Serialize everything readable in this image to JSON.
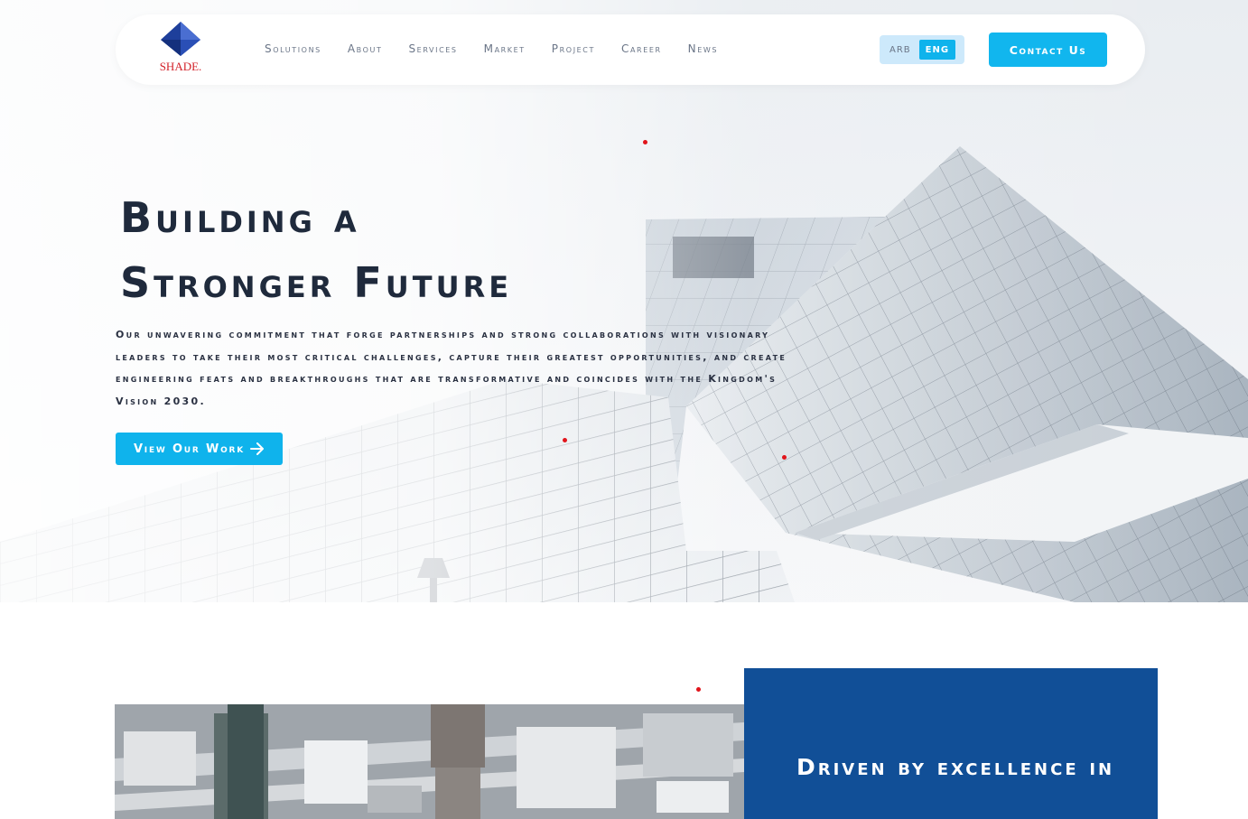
{
  "brand": {
    "logo_text": "SHADE.",
    "colors": {
      "logo_blue": "#1e3f9b",
      "logo_red": "#d3222a"
    }
  },
  "nav": {
    "links": [
      "Solutions",
      "About",
      "Services",
      "Market",
      "Project",
      "Career",
      "News"
    ]
  },
  "language": {
    "arb": "ARB",
    "eng": "ENG",
    "active": "ENG"
  },
  "contact_label": "Contact Us",
  "hero": {
    "title_line1": "Building a",
    "title_line2": "Stronger Future",
    "description": "Our unwavering commitment that forge partnerships and strong collaborations with visionary leaders to take their most critical challenges, capture their greatest opportunities, and create engineering feats and breakthroughs that are transformative and coincides with the Kingdom's Vision 2030.",
    "cta_label": "View Our Work",
    "cta_icon": "arrow-right-icon"
  },
  "feature": {
    "title": "Driven by excellence in"
  },
  "colors": {
    "accent": "#0fb3ec",
    "card_blue": "#114f97",
    "heading_dark": "#1f2a3c",
    "nav_text": "#6a7587"
  }
}
